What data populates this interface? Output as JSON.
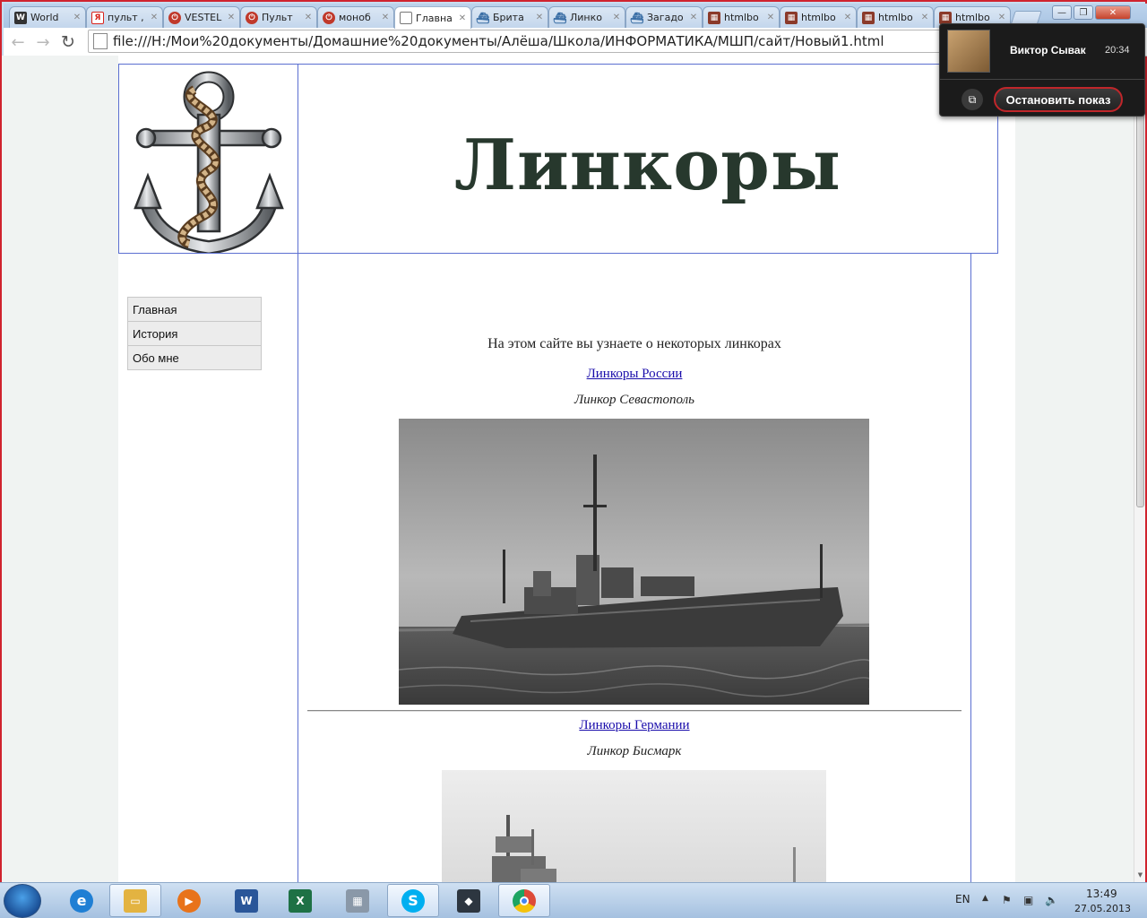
{
  "browser": {
    "tabs": [
      {
        "label": "World",
        "icon": "tank-icon",
        "color": "#333333"
      },
      {
        "label": "пульт ,",
        "icon": "yandex-icon",
        "color": "#d8231c"
      },
      {
        "label": "VESTEL",
        "icon": "power-icon",
        "color": "#c0392b"
      },
      {
        "label": "Пульт",
        "icon": "power-icon",
        "color": "#c0392b"
      },
      {
        "label": "моноб",
        "icon": "power-icon",
        "color": "#c0392b"
      },
      {
        "label": "Главна",
        "icon": "page-icon",
        "color": "#777777",
        "active": true
      },
      {
        "label": "Брита",
        "icon": "ship-icon",
        "color": "#3a6ea5"
      },
      {
        "label": "Линко",
        "icon": "ship-icon",
        "color": "#3a6ea5"
      },
      {
        "label": "Загадо",
        "icon": "ship-icon",
        "color": "#3a6ea5"
      },
      {
        "label": "htmlbo",
        "icon": "htmlbook-icon",
        "color": "#8b3a2a"
      },
      {
        "label": "htmlbo",
        "icon": "htmlbook-icon",
        "color": "#8b3a2a"
      },
      {
        "label": "htmlbo",
        "icon": "htmlbook-icon",
        "color": "#8b3a2a"
      },
      {
        "label": "htmlbo",
        "icon": "htmlbook-icon",
        "color": "#8b3a2a"
      }
    ],
    "url": "file:///H:/Мои%20документы/Домашние%20документы/Алёша/Школа/ИНФОРМАТИКА/МШП/сайт/Новый1.html"
  },
  "site": {
    "title": "Линкоры",
    "menu": [
      "Главная",
      "История",
      "Обо мне"
    ],
    "intro": "На этом сайте вы узнаете о некоторых линкорах",
    "sections": [
      {
        "link": "Линкоры России",
        "caption": "Линкор Севастополь"
      },
      {
        "link": "Линкоры Германии",
        "caption": "Линкор Бисмарк"
      }
    ]
  },
  "screen_share": {
    "name": "Виктор Сывак",
    "time": "20:34",
    "stop_label": "Остановить показ"
  },
  "taskbar": {
    "lang": "EN",
    "time": "13:49",
    "date": "27.05.2013",
    "apps": [
      {
        "name": "ie",
        "color": "#1f7fd4"
      },
      {
        "name": "explorer",
        "color": "#e3b341",
        "active": true
      },
      {
        "name": "media-player",
        "color": "#e8731a"
      },
      {
        "name": "word",
        "color": "#2a5699"
      },
      {
        "name": "excel",
        "color": "#1e7145"
      },
      {
        "name": "calculator",
        "color": "#8a98a8"
      },
      {
        "name": "skype",
        "color": "#00aff0",
        "active": true
      },
      {
        "name": "wot-launcher",
        "color": "#2d3640"
      },
      {
        "name": "chrome",
        "color": "#dd4b39",
        "active": true
      }
    ]
  }
}
